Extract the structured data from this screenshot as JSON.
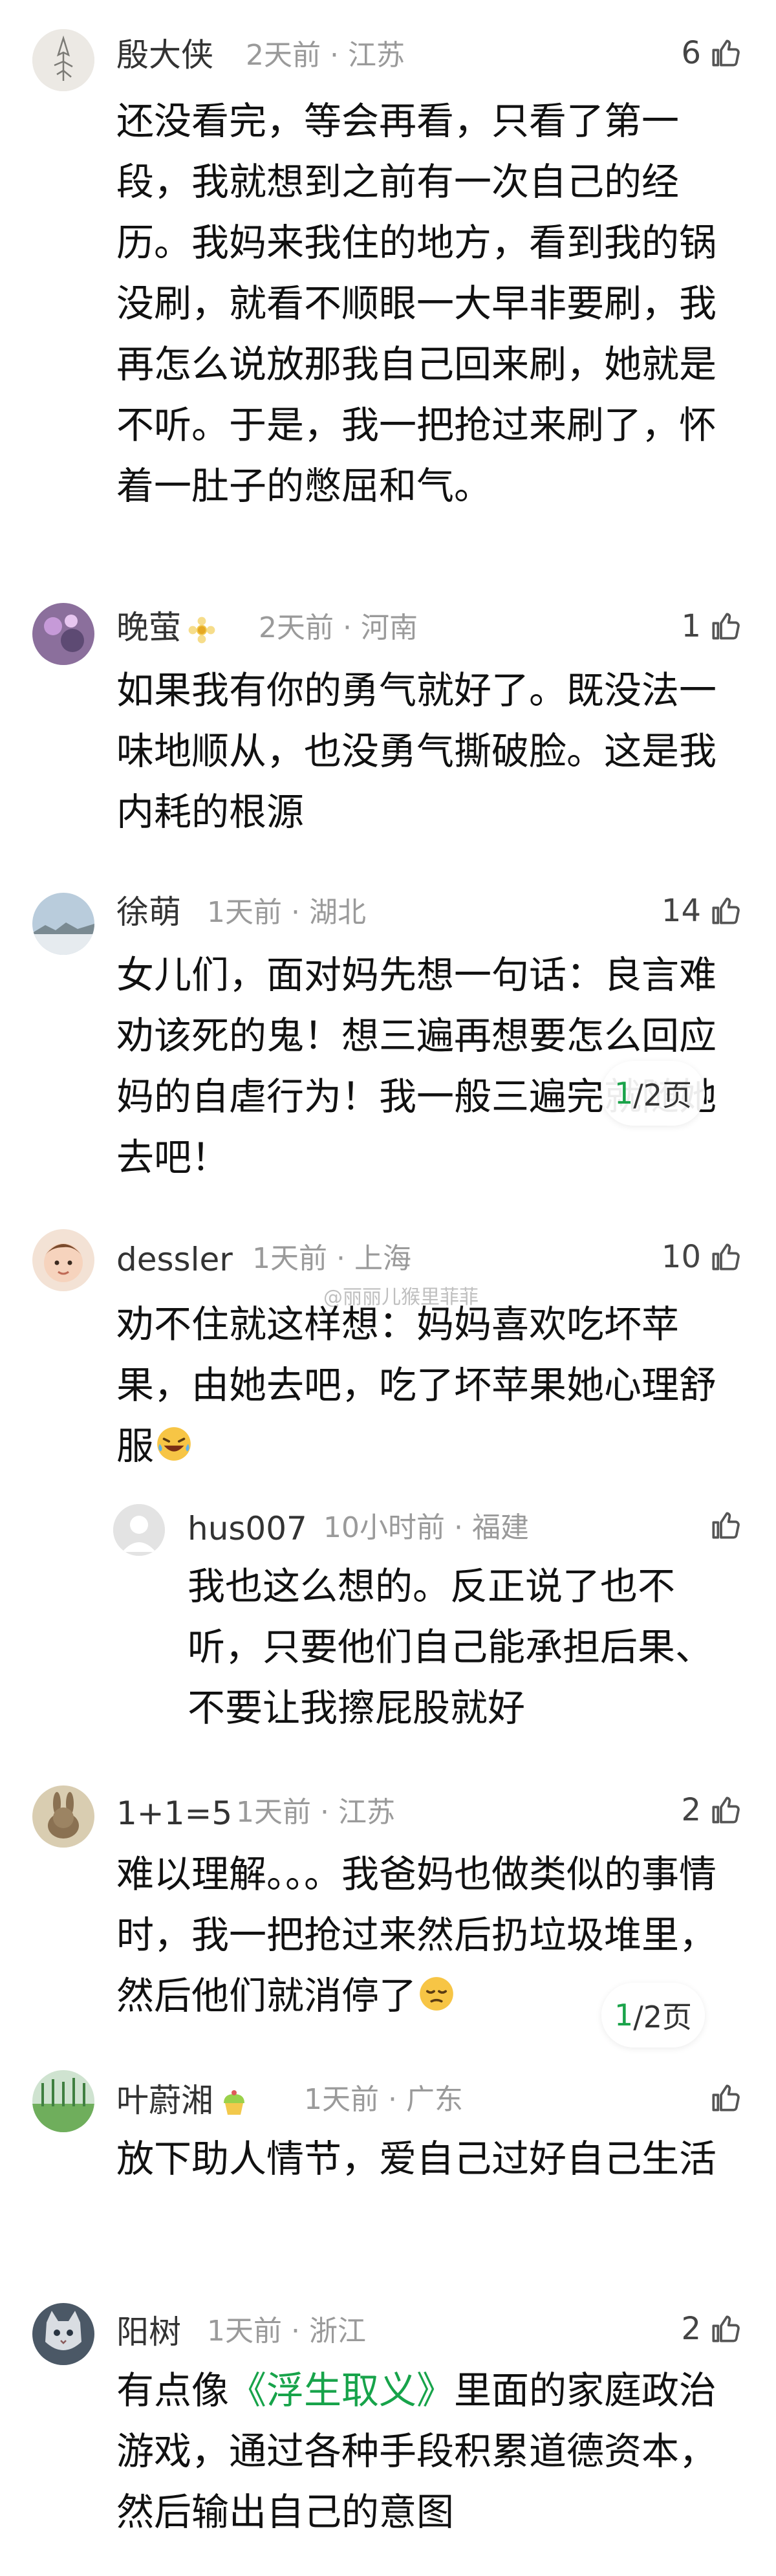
{
  "comments": [
    {
      "name": "殷大侠",
      "time": "2天前",
      "location": "江苏",
      "likes": "6",
      "body": "还没看完，等会再看，只看了第一段，我就想到之前有一次自己的经历。我妈来我住的地方，看到我的锅没刷，就看不顺眼一大早非要刷，我再怎么说放那我自己回来刷，她就是不听。于是，我一把抢过来刷了，怀着一肚子的憋屈和气。"
    },
    {
      "name": "晚萤",
      "time": "2天前",
      "location": "河南",
      "likes": "1",
      "body": "如果我有你的勇气就好了。既没法一味地顺从，也没勇气撕破脸。这是我内耗的根源"
    },
    {
      "name": "徐萌",
      "time": "1天前",
      "location": "湖北",
      "likes": "14",
      "body": "女儿们，面对妈先想一句话：良言难劝该死的鬼！想三遍再想要怎么回应妈的自虐行为！我一般三遍完就随她去吧！"
    },
    {
      "name": "dessler",
      "time": "1天前",
      "location": "上海",
      "likes": "10",
      "body": "劝不住就这样想：妈妈喜欢吃坏苹果，由她去吧，吃了坏苹果她心理舒服"
    },
    {
      "name": "hus007",
      "time": "10小时前",
      "location": "福建",
      "likes": "",
      "body": "我也这么想的。反正说了也不听，只要他们自己能承担后果、不要让我擦屁股就好"
    },
    {
      "name": "1+1=5",
      "time": "1天前",
      "location": "江苏",
      "likes": "2",
      "body": "难以理解。。。我爸妈也做类似的事情时，我一把抢过来然后扔垃圾堆里，然后他们就消停了"
    },
    {
      "name": "叶蔚湘",
      "time": "1天前",
      "location": "广东",
      "likes": "",
      "body": "放下助人情节，爱自己过好自己生活"
    },
    {
      "name": "阳树",
      "time": "1天前",
      "location": "浙江",
      "likes": "2",
      "body_before": "有点像",
      "body_link": "《浮生取义》",
      "body_after": "里面的家庭政治游戏，通过各种手段积累道德资本，然后输出自己的意图"
    }
  ],
  "page_indicators": [
    {
      "current": "1",
      "total": "/2页"
    },
    {
      "current": "1",
      "total": "/2页"
    }
  ],
  "watermark": "@丽丽儿猴里菲菲",
  "icons": {
    "like": "thumbs-up-icon",
    "meta_separator": "·"
  }
}
